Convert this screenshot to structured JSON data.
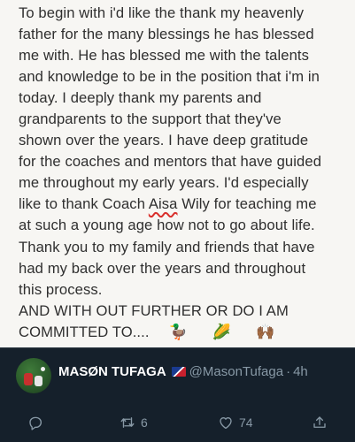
{
  "note": {
    "lines": [
      "To begin with i'd like the thank my heavenly",
      "father for the many blessings he has blessed",
      "me with. He has blessed me with the talents",
      "and knowledge to be in the position that i'm in",
      "today. I deeply thank my parents and",
      "grandparents to the support that they've",
      "shown over the years. I have deep gratitude",
      "for the coaches and mentors that have guided",
      "me throughout my early years. I'd especially",
      "like to thank Coach ",
      "Aisa",
      " Wily for teaching me",
      "at such a young age how not to go about life.",
      "Thank you to my family and friends that have",
      "had my back over the years and throughout",
      "this process.",
      "AND WITH OUT FURTHER OR DO I AM",
      "COMMITTED TO...."
    ],
    "emojis": [
      "🦆",
      "🌽",
      "🙌🏾"
    ]
  },
  "tweet": {
    "display_name": "MASØN TUFAGA",
    "handle": "@MasonTufaga",
    "separator": "·",
    "time": "4h"
  },
  "actions": {
    "retweets": "6",
    "likes": "74"
  },
  "colors": {
    "background": "#15202b",
    "note_paper": "#f7f6f3",
    "muted": "#8899a6"
  }
}
